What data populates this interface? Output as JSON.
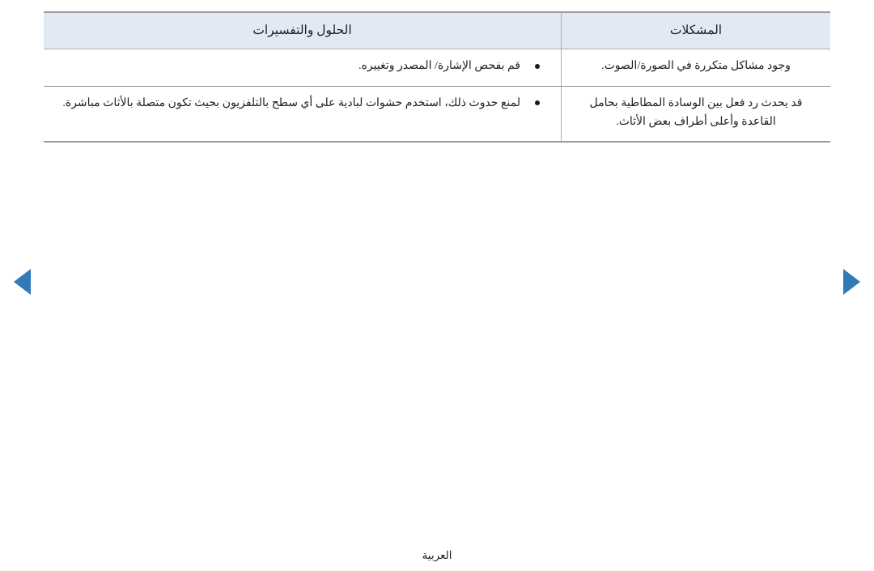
{
  "document": {
    "language_label": "العربية",
    "direction": "rtl"
  },
  "navigation": {
    "prev_label": "◀",
    "next_label": "▶",
    "arrow_color": "#3179b7"
  },
  "table": {
    "header_background": "#e1e9f2",
    "headers": {
      "problems": "المشكلات",
      "solutions": "الحلول والتفسيرات"
    },
    "rows": [
      {
        "problem": "وجود مشاكل متكررة في الصورة/الصوت.",
        "solutions": [
          "قم بفحص الإشارة/ المصدر وتغييره."
        ]
      },
      {
        "problem": "قد يحدث رد فعل بين الوسادة المطاطية بحامل القاعدة وأعلى أطراف بعض الأثاث.",
        "solutions": [
          "لمنع حدوث ذلك، استخدم حشوات لبادية على أي سطح بالتلفزيون بحيث تكون متصلة بالأثاث مباشرة."
        ]
      }
    ]
  }
}
